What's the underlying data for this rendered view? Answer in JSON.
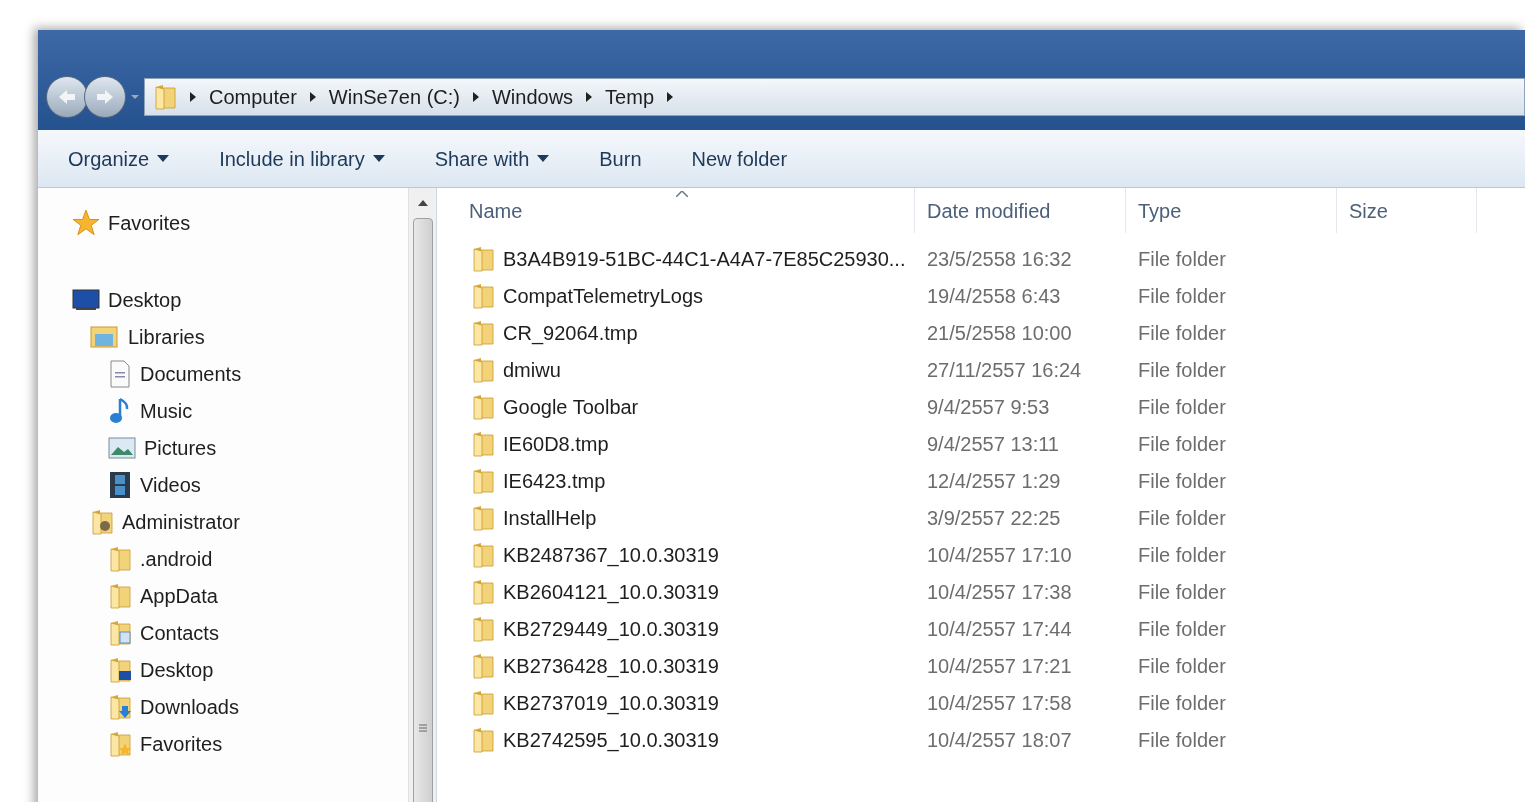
{
  "address_bar": {
    "segments": [
      "Computer",
      "WinSe7en (C:)",
      "Windows",
      "Temp"
    ]
  },
  "toolbar": [
    {
      "label": "Organize",
      "dropdown": true
    },
    {
      "label": "Include in library",
      "dropdown": true
    },
    {
      "label": "Share with",
      "dropdown": true
    },
    {
      "label": "Burn",
      "dropdown": false
    },
    {
      "label": "New folder",
      "dropdown": false
    }
  ],
  "nav_pane": [
    {
      "label": "Favorites",
      "kind": "star"
    },
    {
      "label": "Desktop",
      "kind": "desktop",
      "children": [
        {
          "label": "Libraries",
          "kind": "libraries",
          "children": [
            {
              "label": "Documents",
              "kind": "documents"
            },
            {
              "label": "Music",
              "kind": "music"
            },
            {
              "label": "Pictures",
              "kind": "pictures"
            },
            {
              "label": "Videos",
              "kind": "videos"
            }
          ]
        },
        {
          "label": "Administrator",
          "kind": "user",
          "children": [
            {
              "label": ".android",
              "kind": "folder"
            },
            {
              "label": "AppData",
              "kind": "folder"
            },
            {
              "label": "Contacts",
              "kind": "contacts"
            },
            {
              "label": "Desktop",
              "kind": "desktop-folder"
            },
            {
              "label": "Downloads",
              "kind": "downloads"
            },
            {
              "label": "Favorites",
              "kind": "favorites-folder"
            }
          ]
        }
      ]
    }
  ],
  "columns": [
    {
      "label": "Name",
      "sorted": true
    },
    {
      "label": "Date modified",
      "sorted": false
    },
    {
      "label": "Type",
      "sorted": false
    },
    {
      "label": "Size",
      "sorted": false
    }
  ],
  "rows": [
    {
      "name": "B3A4B919-51BC-44C1-A4A7-7E85C25930...",
      "date": "23/5/2558 16:32",
      "type": "File folder"
    },
    {
      "name": "CompatTelemetryLogs",
      "date": "19/4/2558 6:43",
      "type": "File folder"
    },
    {
      "name": "CR_92064.tmp",
      "date": "21/5/2558 10:00",
      "type": "File folder"
    },
    {
      "name": "dmiwu",
      "date": "27/11/2557 16:24",
      "type": "File folder"
    },
    {
      "name": "Google Toolbar",
      "date": "9/4/2557 9:53",
      "type": "File folder"
    },
    {
      "name": "IE60D8.tmp",
      "date": "9/4/2557 13:11",
      "type": "File folder"
    },
    {
      "name": "IE6423.tmp",
      "date": "12/4/2557 1:29",
      "type": "File folder"
    },
    {
      "name": "InstallHelp",
      "date": "3/9/2557 22:25",
      "type": "File folder"
    },
    {
      "name": "KB2487367_10.0.30319",
      "date": "10/4/2557 17:10",
      "type": "File folder"
    },
    {
      "name": "KB2604121_10.0.30319",
      "date": "10/4/2557 17:38",
      "type": "File folder"
    },
    {
      "name": "KB2729449_10.0.30319",
      "date": "10/4/2557 17:44",
      "type": "File folder"
    },
    {
      "name": "KB2736428_10.0.30319",
      "date": "10/4/2557 17:21",
      "type": "File folder"
    },
    {
      "name": "KB2737019_10.0.30319",
      "date": "10/4/2557 17:58",
      "type": "File folder"
    },
    {
      "name": "KB2742595_10.0.30319",
      "date": "10/4/2557 18:07",
      "type": "File folder"
    }
  ]
}
